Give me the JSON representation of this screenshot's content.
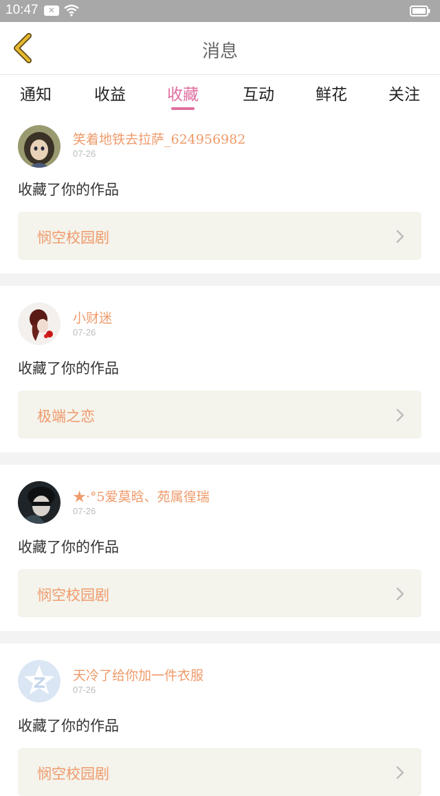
{
  "status_bar": {
    "time": "10:47",
    "notification_icon": "close-box-icon",
    "wifi_icon": "wifi-icon",
    "battery_icon": "battery-icon"
  },
  "header": {
    "back_icon": "chevron-left-icon",
    "title": "消息",
    "accent_color": "#e8b830"
  },
  "tabs": [
    {
      "label": "通知",
      "active": false
    },
    {
      "label": "收益",
      "active": false
    },
    {
      "label": "收藏",
      "active": true
    },
    {
      "label": "互动",
      "active": false
    },
    {
      "label": "鲜花",
      "active": false
    },
    {
      "label": "关注",
      "active": false
    }
  ],
  "colors": {
    "active_tab": "#e06ea0",
    "username": "#ef9a6a",
    "work_box_bg": "#f4f3ec"
  },
  "messages": [
    {
      "username": "笑着地铁去拉萨_624956982",
      "date": "07-26",
      "action": "收藏了你的作品",
      "work_title": "悯空校园剧",
      "avatar_icon": "avatar"
    },
    {
      "username": "小财迷",
      "date": "07-26",
      "action": "收藏了你的作品",
      "work_title": "极端之恋",
      "avatar_icon": "avatar"
    },
    {
      "username": "★·°5爱莫晗、苑属徨瑞",
      "date": "07-26",
      "action": "收藏了你的作品",
      "work_title": "悯空校园剧",
      "avatar_icon": "avatar"
    },
    {
      "username": "天冷了给你加一件衣服",
      "date": "07-26",
      "action": "收藏了你的作品",
      "work_title": "悯空校园剧",
      "avatar_icon": "qzone-avatar-icon"
    }
  ]
}
